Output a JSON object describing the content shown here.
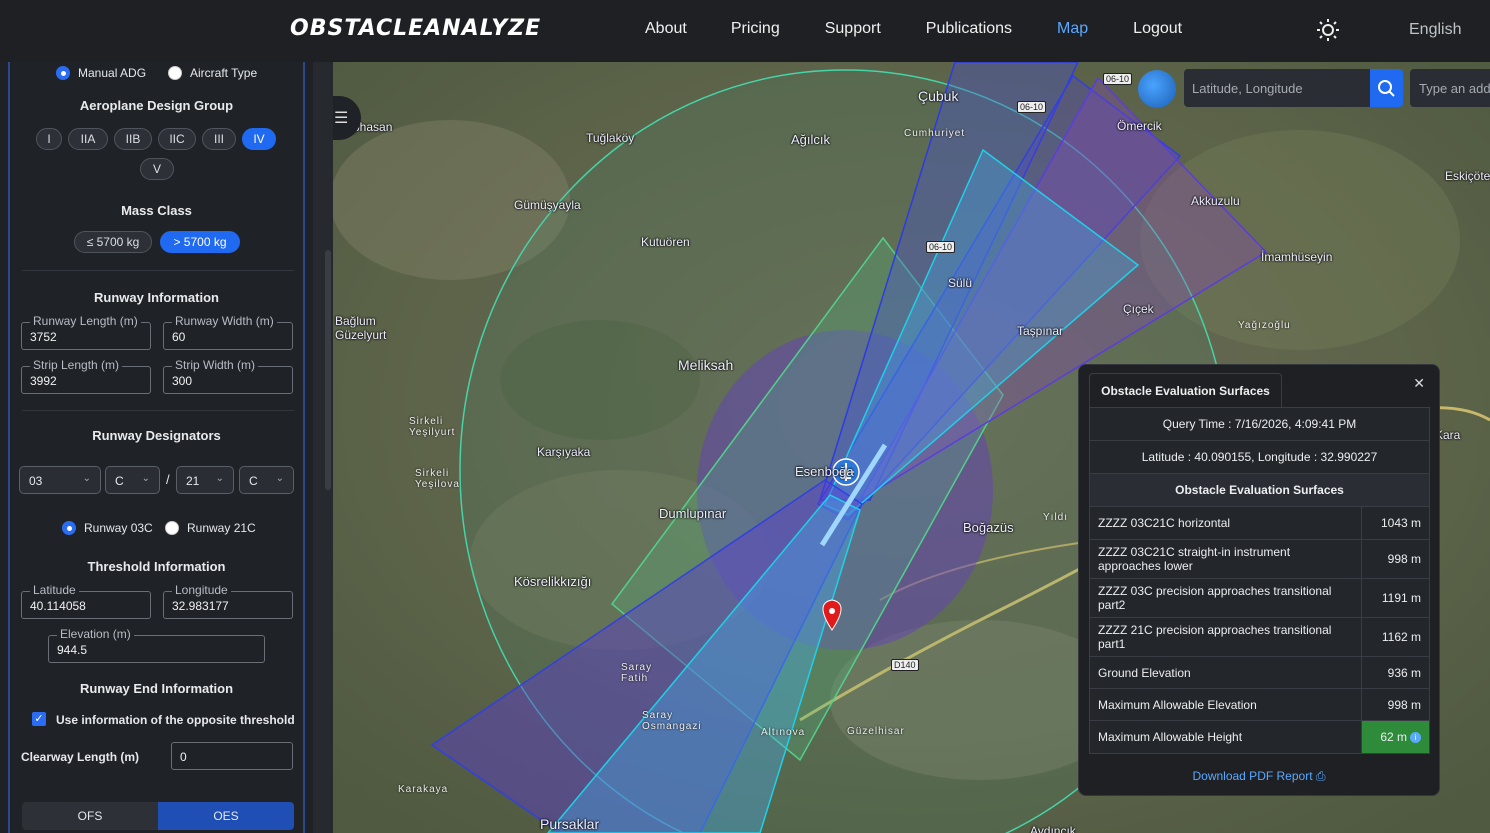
{
  "header": {
    "logo": "OBSTACLEANALYZE",
    "nav": [
      "About",
      "Pricing",
      "Support",
      "Publications",
      "Map",
      "Logout"
    ],
    "active_nav": "Map",
    "language": "English"
  },
  "sidebar": {
    "mode_options": [
      "Manual ADG",
      "Aircraft Type"
    ],
    "mode_selected": "Manual ADG",
    "adg_title": "Aeroplane Design Group",
    "adg_options": [
      "I",
      "IIA",
      "IIB",
      "IIC",
      "III",
      "IV",
      "V"
    ],
    "adg_selected": "IV",
    "mass_title": "Mass Class",
    "mass_options": [
      "≤ 5700 kg",
      "> 5700 kg"
    ],
    "mass_selected": "> 5700 kg",
    "runway_info_title": "Runway Information",
    "runway_length_label": "Runway Length (m)",
    "runway_length": "3752",
    "runway_width_label": "Runway Width (m)",
    "runway_width": "60",
    "strip_length_label": "Strip Length (m)",
    "strip_length": "3992",
    "strip_width_label": "Strip Width (m)",
    "strip_width": "300",
    "designators_title": "Runway Designators",
    "des_1": "03",
    "des_2": "C",
    "des_sep": "/",
    "des_3": "21",
    "des_4": "C",
    "runway_options": [
      "Runway 03C",
      "Runway 21C"
    ],
    "runway_selected": "Runway 03C",
    "threshold_title": "Threshold Information",
    "latitude_label": "Latitude",
    "latitude": "40.114058",
    "longitude_label": "Longitude",
    "longitude": "32.983177",
    "elevation_label": "Elevation (m)",
    "elevation": "944.5",
    "runway_end_title": "Runway End Information",
    "opposite_threshold_label": "Use information of the opposite threshold",
    "opposite_threshold_checked": true,
    "clearway_label": "Clearway Length (m)",
    "clearway": "0",
    "toggle": [
      "OFS",
      "OES"
    ],
    "toggle_selected": "OES"
  },
  "map": {
    "search_placeholder": "Latitude, Longitude",
    "address_placeholder": "Type an address",
    "labels": [
      "Çubuk",
      "Ağılcık",
      "Tuğlaköy",
      "Gümüşyayla",
      "Kutuören",
      "Bağlum Güzelyurt",
      "Meliksah",
      "Karşıyaka",
      "Esenboğa",
      "Dumlupınar",
      "Kösrelikkızığı",
      "Boğazüs",
      "Pursaklar",
      "Ömercik",
      "Akkuzulu",
      "Eskiçöte",
      "İmamhüseyin",
      "Yağızoğlu",
      "Kara",
      "Cumhuriyet",
      "Sirkeli Yeşilyurt",
      "Sirkeli Yeşilova",
      "Saray Fatih",
      "Saray Osmangazi",
      "Altınova",
      "Güzelhisar",
      "Karakaya",
      "Sülü",
      "Taşpınar",
      "Çıçek",
      "Yıldı",
      "phasan",
      "Aydıncık"
    ],
    "road_badges": [
      "06-10",
      "06-10",
      "06-10",
      "D140"
    ]
  },
  "panel": {
    "tab": "Obstacle Evaluation Surfaces",
    "query_time": "Query Time : 7/16/2026, 4:09:41 PM",
    "coords": "Latitude : 40.090155, Longitude : 32.990227",
    "section_title": "Obstacle Evaluation Surfaces",
    "rows": [
      {
        "name": "ZZZZ 03C21C horizontal",
        "value": "1043 m"
      },
      {
        "name": "ZZZZ 03C21C straight-in instrument approaches lower",
        "value": "998 m"
      },
      {
        "name": "ZZZZ 03C precision approaches transitional part2",
        "value": "1191 m"
      },
      {
        "name": "ZZZZ 21C precision approaches transitional part1",
        "value": "1162 m"
      },
      {
        "name": "Ground Elevation",
        "value": "936 m"
      },
      {
        "name": "Maximum Allowable Elevation",
        "value": "998 m"
      },
      {
        "name": "Maximum Allowable Height",
        "value": "62 m"
      }
    ],
    "download": "Download PDF Report",
    "highlight_color": "#2e8b3a"
  }
}
